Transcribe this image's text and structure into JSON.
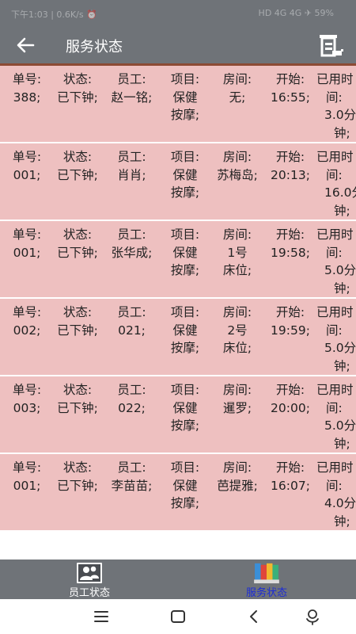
{
  "status_bar": {
    "left_text": "下午1:03 | 0.6K/s ⏰",
    "right_text": "HD 4G 4G ✈ 59%"
  },
  "header": {
    "title": "服务状态",
    "back_icon": "back-arrow-icon",
    "menu_icon": "menu-doc-icon"
  },
  "colors": {
    "bar_bg": "#6f7378",
    "card_bg": "#eec0c0",
    "accent_line": "#8c4a34",
    "active_tab": "#1b2bd6"
  },
  "records": [
    {
      "c1": [
        "单号:",
        "388;"
      ],
      "c2": [
        "状态:",
        "已下钟;"
      ],
      "c3": [
        "员工:",
        "赵一铭;"
      ],
      "c4": [
        "项目:",
        "保健",
        "按摩;"
      ],
      "c5": [
        "房间:",
        "无;"
      ],
      "c6": [
        "开始:",
        "16:55;"
      ],
      "c7": [
        "已用时",
        "间:",
        "3.0分",
        "钟;"
      ]
    },
    {
      "c1": [
        "单号:",
        "001;"
      ],
      "c2": [
        "状态:",
        "已下钟;"
      ],
      "c3": [
        "员工:",
        "肖肖;"
      ],
      "c4": [
        "项目:",
        "保健",
        "按摩;"
      ],
      "c5": [
        "房间:",
        "苏梅岛;"
      ],
      "c6": [
        "开始:",
        "20:13;"
      ],
      "c7": [
        "已用时",
        "间:",
        "16.0分",
        "钟;"
      ]
    },
    {
      "c1": [
        "单号:",
        "001;"
      ],
      "c2": [
        "状态:",
        "已下钟;"
      ],
      "c3": [
        "员工:",
        "张华成;"
      ],
      "c4": [
        "项目:",
        "保健",
        "按摩;"
      ],
      "c5": [
        "房间:",
        "1号",
        "床位;"
      ],
      "c6": [
        "开始:",
        "19:58;"
      ],
      "c7": [
        "已用时",
        "间:",
        "5.0分",
        "钟;"
      ]
    },
    {
      "c1": [
        "单号:",
        "002;"
      ],
      "c2": [
        "状态:",
        "已下钟;"
      ],
      "c3": [
        "员工:",
        "021;"
      ],
      "c4": [
        "项目:",
        "保健",
        "按摩;"
      ],
      "c5": [
        "房间:",
        "2号",
        "床位;"
      ],
      "c6": [
        "开始:",
        "19:59;"
      ],
      "c7": [
        "已用时",
        "间:",
        "5.0分",
        "钟;"
      ]
    },
    {
      "c1": [
        "单号:",
        "003;"
      ],
      "c2": [
        "状态:",
        "已下钟;"
      ],
      "c3": [
        "员工:",
        "022;"
      ],
      "c4": [
        "项目:",
        "保健",
        "按摩;"
      ],
      "c5": [
        "房间:",
        "暹罗;"
      ],
      "c6": [
        "开始:",
        "20:00;"
      ],
      "c7": [
        "已用时",
        "间:",
        "5.0分",
        "钟;"
      ]
    },
    {
      "c1": [
        "单号:",
        "001;"
      ],
      "c2": [
        "状态:",
        "已下钟;"
      ],
      "c3": [
        "员工:",
        "李苗苗;"
      ],
      "c4": [
        "项目:",
        "保健",
        "按摩;"
      ],
      "c5": [
        "房间:",
        "芭提雅;"
      ],
      "c6": [
        "开始:",
        "16:07;"
      ],
      "c7": [
        "已用时",
        "间:",
        "4.0分",
        "钟;"
      ]
    }
  ],
  "tabs": [
    {
      "id": "staff",
      "label": "员工状态",
      "icon": "staff-group-icon",
      "active": false
    },
    {
      "id": "service",
      "label": "服务状态",
      "icon": "service-book-icon",
      "active": true
    }
  ],
  "system_nav": [
    "menu-lines-icon",
    "home-square-icon",
    "back-chevron-icon",
    "assistant-icon"
  ]
}
